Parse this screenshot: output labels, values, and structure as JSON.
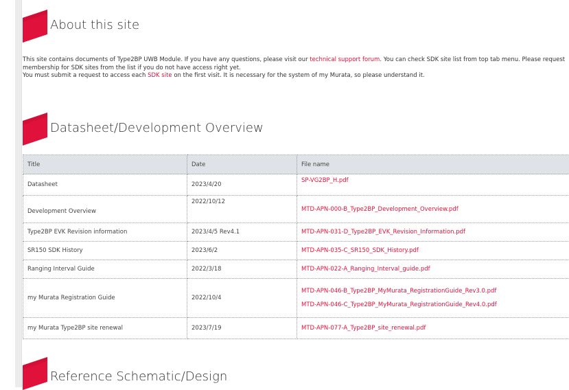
{
  "about": {
    "title": "About this site",
    "line1_a": "This site contains documents of Type2BP UWB Module. If you have any questions, please visit our ",
    "line1_link": "technical support forum",
    "line1_b": ". You can check SDK site list from top tab menu. Please request membership for SDK sites from the list if you do not have access right yet.",
    "line2_a": "You must submit a request to access each ",
    "line2_link": "SDK site",
    "line2_b": " on the first visit.  It is necessary for the system of my Murata, so please understand it."
  },
  "datasheet": {
    "title": "Datasheet/Development Overview",
    "columns": [
      "Title",
      "Date",
      "File name"
    ],
    "rows": [
      {
        "title": "Datasheet",
        "date": "2023/4/20",
        "files": [
          "SP-VG2BP_H.pdf"
        ]
      },
      {
        "title": "Development Overview",
        "date": "2022/10/12",
        "files": [
          "MTD-APN-000-B_Type2BP_Development_Overview.pdf"
        ]
      },
      {
        "title": "Type2BP EVK Revision information",
        "date": "2023/4/5  Rev4.1",
        "files": [
          "MTD-APN-031-D_Type2BP_EVK_Revision_Information.pdf"
        ]
      },
      {
        "title": "SR150 SDK History",
        "date": "2023/6/2",
        "files": [
          "MTD-APN-035-C_SR150_SDK_History.pdf"
        ]
      },
      {
        "title": "Ranging Interval Guide",
        "date": "2022/3/18",
        "files": [
          "MTD-APN-022-A_Ranging_Interval_guide.pdf"
        ]
      },
      {
        "title": "my Murata Registration Guide",
        "date": "2022/10/4",
        "files": [
          "MTD-APN-046-B_Type2BP_MyMurata_RegistrationGuide_Rev3.0.pdf",
          "MTD-APN-046-C_Type2BP_MyMurata_RegistrationGuide_Rev4.0.pdf"
        ]
      },
      {
        "title": "my Murata Type2BP site renewal",
        "date": "2023/7/19",
        "files": [
          "MTD-APN-077-A_Type2BP_site_renewal.pdf"
        ]
      }
    ]
  },
  "reference": {
    "title": "Reference Schematic/Design"
  },
  "colors": {
    "accent": "#e0123b",
    "table_header_bg": "#dfe3e8"
  }
}
